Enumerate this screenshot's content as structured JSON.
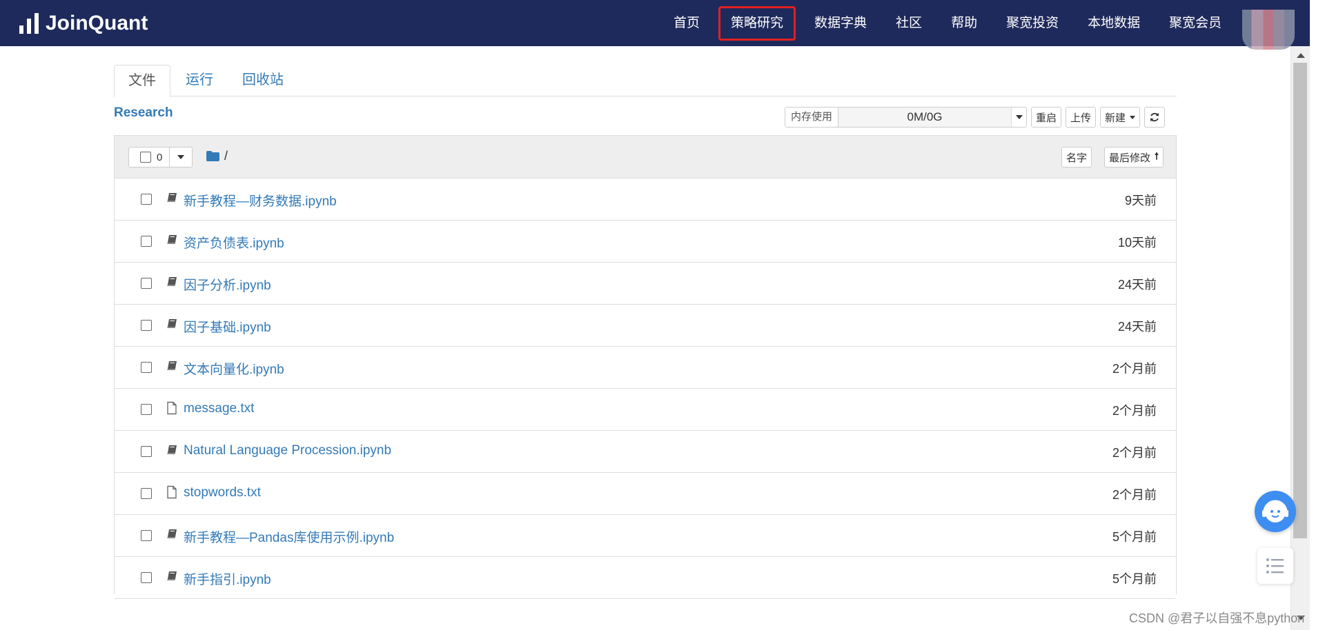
{
  "brand": {
    "name": "JoinQuant"
  },
  "nav": {
    "items": [
      "首页",
      "策略研究",
      "数据字典",
      "社区",
      "帮助",
      "聚宽投资",
      "本地数据",
      "聚宽会员"
    ],
    "active": "策略研究"
  },
  "tabs": [
    {
      "label": "文件",
      "active": true
    },
    {
      "label": "运行",
      "active": false
    },
    {
      "label": "回收站",
      "active": false
    }
  ],
  "breadcrumb": {
    "title": "Research",
    "path": "/"
  },
  "toolbar": {
    "memory_label": "内存使用",
    "memory_value": "0M/0G",
    "restart_label": "重启",
    "upload_label": "上传",
    "new_label": "新建"
  },
  "list_header": {
    "selected_count": "0",
    "sort_name_label": "名字",
    "sort_modified_label": "最后修改"
  },
  "files": [
    {
      "name": "新手教程—财务数据.ipynb",
      "modified": "9天前",
      "type": "notebook"
    },
    {
      "name": "资产负债表.ipynb",
      "modified": "10天前",
      "type": "notebook"
    },
    {
      "name": "因子分析.ipynb",
      "modified": "24天前",
      "type": "notebook"
    },
    {
      "name": "因子基础.ipynb",
      "modified": "24天前",
      "type": "notebook"
    },
    {
      "name": "文本向量化.ipynb",
      "modified": "2个月前",
      "type": "notebook"
    },
    {
      "name": "message.txt",
      "modified": "2个月前",
      "type": "file"
    },
    {
      "name": "Natural Language Procession.ipynb",
      "modified": "2个月前",
      "type": "notebook"
    },
    {
      "name": "stopwords.txt",
      "modified": "2个月前",
      "type": "file"
    },
    {
      "name": "新手教程—Pandas库使用示例.ipynb",
      "modified": "5个月前",
      "type": "notebook"
    },
    {
      "name": "新手指引.ipynb",
      "modified": "5个月前",
      "type": "notebook"
    }
  ],
  "watermark": "CSDN @君子以自强不息python",
  "colors": {
    "nav_bg": "#1f2a5c",
    "link": "#337ab7",
    "highlight": "#e32020",
    "support": "#3d8ef0"
  }
}
